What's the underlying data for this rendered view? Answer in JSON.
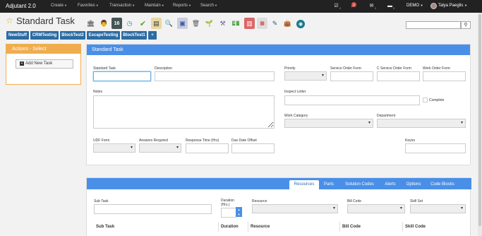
{
  "topbar": {
    "brand": "Adjutant 2.0",
    "nav": [
      "Create",
      "Favorites",
      "Transaction",
      "Maintain",
      "Reports",
      "Search"
    ],
    "counts": {
      "tasks": "0",
      "mail": "0",
      "messages": "0"
    },
    "badge": "5",
    "demo": "DEMO",
    "user": "Talya Paeglis"
  },
  "page_title": "Standard Task",
  "toolbar_icons": [
    "museum-icon",
    "person-icon",
    "calendar-icon",
    "clock-icon",
    "checkmark-icon",
    "notes-icon",
    "magnifier-icon",
    "monitor-icon",
    "trash-icon",
    "plant-icon",
    "tools-icon",
    "money-icon",
    "book-icon",
    "calendar-page-icon",
    "pencil-icon",
    "bag-icon",
    "tasklist-icon",
    "globe-icon"
  ],
  "buttons": [
    "NewStuff",
    "CRMTesting",
    "BlockTest2",
    "EscapeTesting",
    "BlockTest1",
    "+"
  ],
  "actions": {
    "title": "Actions - Select",
    "add_task": "Add New Task"
  },
  "form": {
    "title": "Standard Task",
    "standard_task": "Standard Task",
    "description": "Description",
    "priority": "Priority",
    "service_order_form": "Service Order Form",
    "c_service_order_form": "C Service Order Form",
    "work_order_form": "Work Order Form",
    "notes": "Notes",
    "inspect_letter": "Inspect Letter",
    "complete": "Complete",
    "work_category": "Work Category",
    "department": "Department",
    "udf_form": "UDF Form",
    "answers_required": "Answers Required",
    "response_time": "Response Time (Hrs)",
    "due_date_offset": "Due Date Offset",
    "keyno": "Keyno"
  },
  "tabs": [
    "Resources",
    "Parts",
    "Solution Codes",
    "Alerts",
    "Options",
    "Code Blocks"
  ],
  "subtask_form": {
    "sub_task": "Sub Task",
    "duration": "Duration",
    "duration_unit": "(Hrs.)",
    "resource": "Resource",
    "bill_code": "Bill Code",
    "skill_set": "Skill Set"
  },
  "table_headers": [
    "Sub Task",
    "Duration",
    "Resource",
    "Bill Code",
    "Skill Code"
  ]
}
